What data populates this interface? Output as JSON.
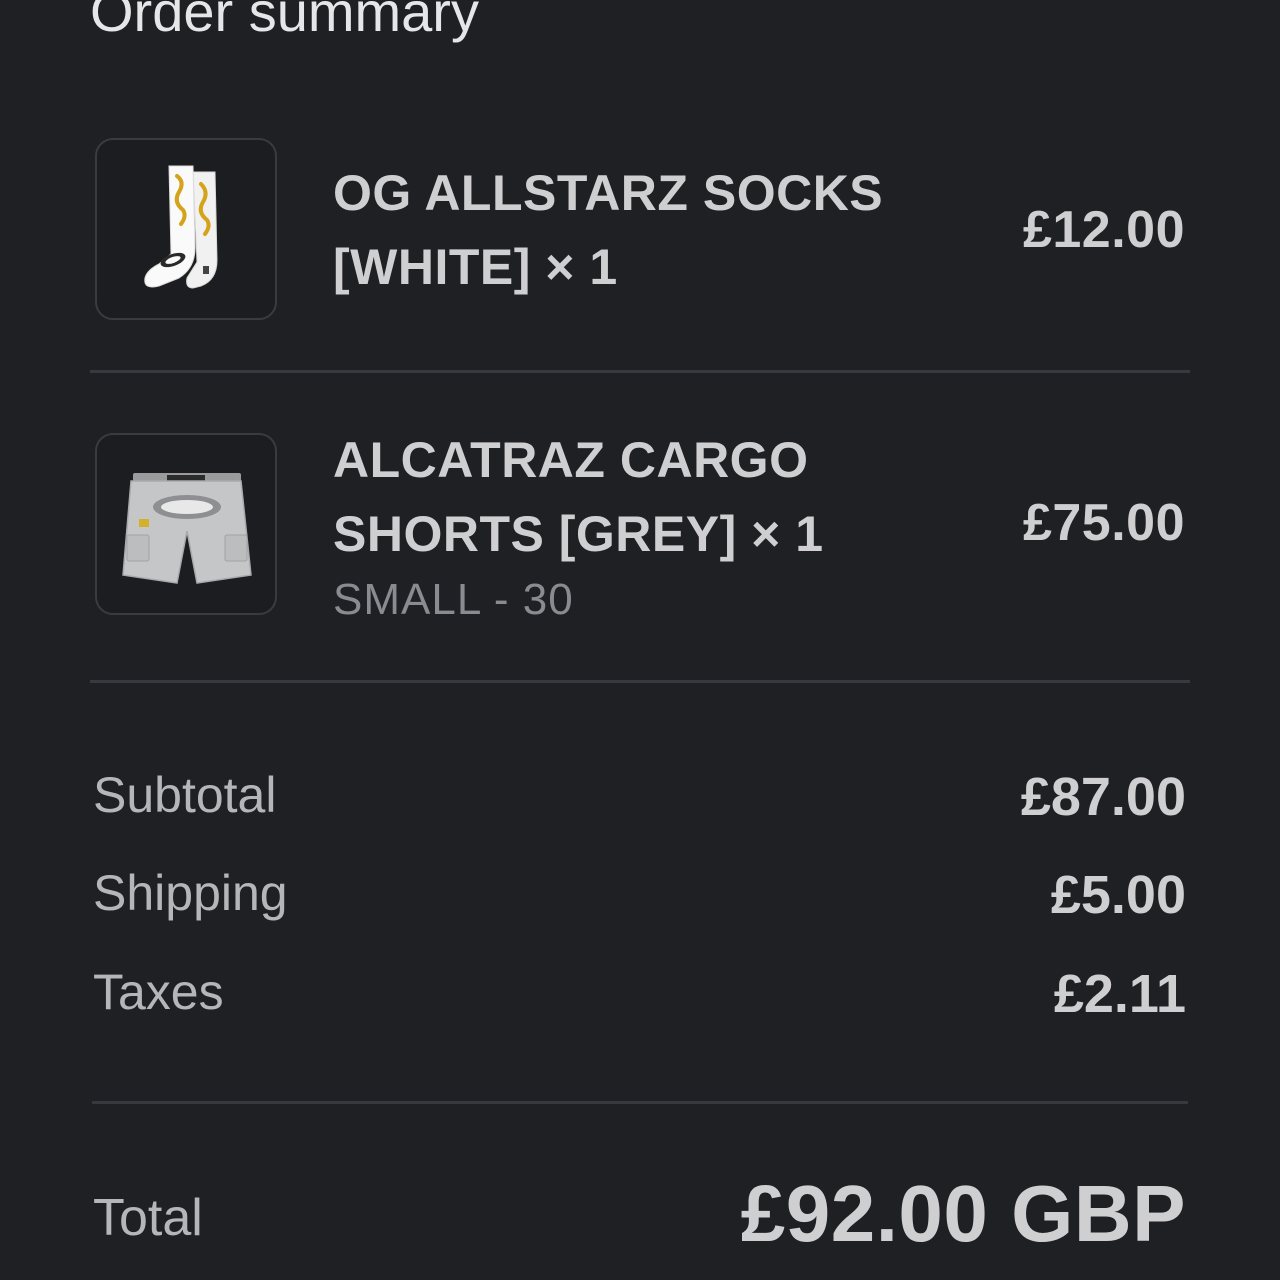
{
  "header": {
    "title": "Order summary"
  },
  "items": [
    {
      "name": "OG ALLSTARZ SOCKS [WHITE] × 1",
      "variant": "",
      "price": "£12.00",
      "thumbnail_icon": "socks-image"
    },
    {
      "name": "ALCATRAZ CARGO SHORTS [GREY] × 1",
      "variant": "SMALL - 30",
      "price": "£75.00",
      "thumbnail_icon": "shorts-image"
    }
  ],
  "summary": {
    "subtotal_label": "Subtotal",
    "subtotal_value": "£87.00",
    "shipping_label": "Shipping",
    "shipping_value": "£5.00",
    "taxes_label": "Taxes",
    "taxes_value": "£2.11"
  },
  "total": {
    "label": "Total",
    "value": "£92.00 GBP"
  },
  "colors": {
    "background": "#1f2024",
    "text_primary": "#cfcfd1",
    "text_secondary": "#8a8b90",
    "divider": "#38393e"
  }
}
